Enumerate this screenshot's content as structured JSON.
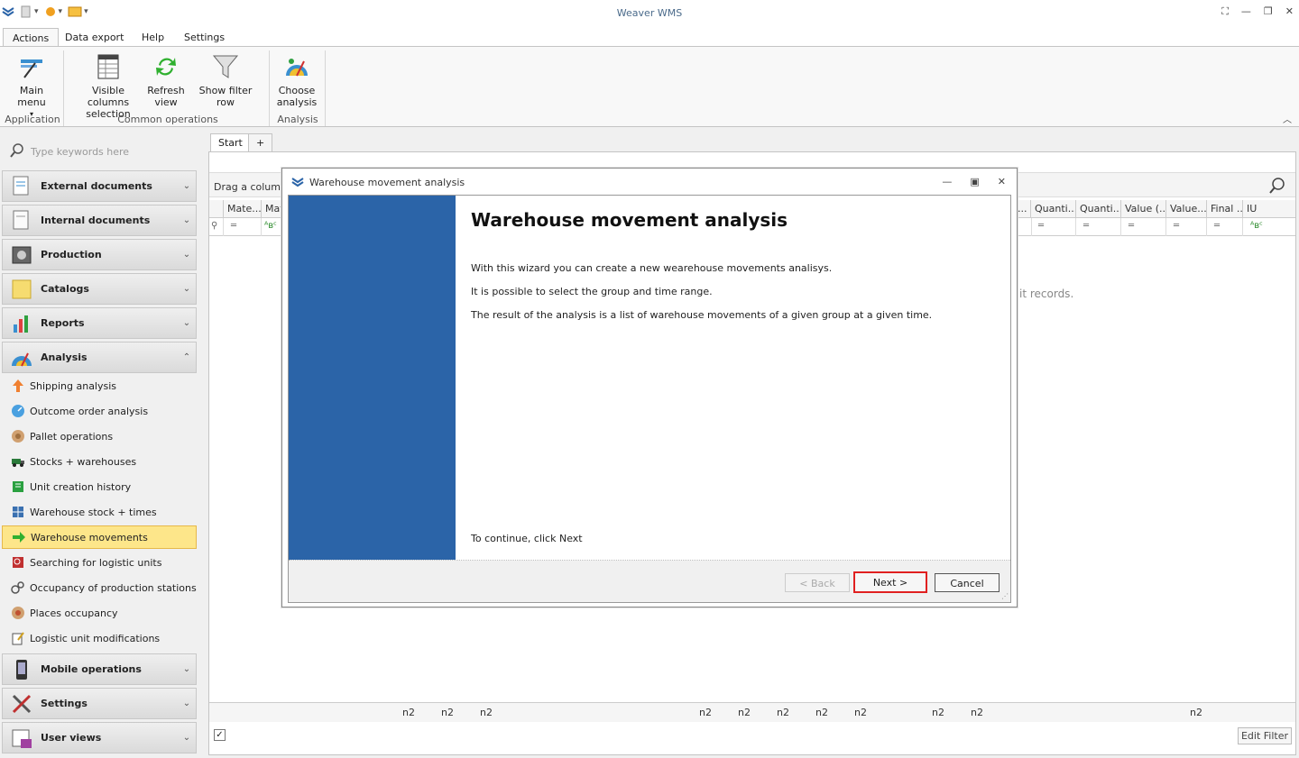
{
  "app": {
    "title": "Weaver WMS"
  },
  "ribbon": {
    "tabs": [
      "Actions",
      "Data export",
      "Help",
      "Settings"
    ],
    "buttons": {
      "main_menu": "Main menu",
      "visible_columns": "Visible columns selection",
      "refresh_view": "Refresh view",
      "show_filter_row": "Show filter row",
      "choose_analysis": "Choose analysis"
    },
    "groups": {
      "application": "Application",
      "common_operations": "Common operations",
      "analysis": "Analysis"
    }
  },
  "sidebar": {
    "search_placeholder": "Type keywords here",
    "groups": [
      "External documents",
      "Internal documents",
      "Production",
      "Catalogs",
      "Reports",
      "Analysis",
      "Mobile operations",
      "Settings",
      "User views"
    ],
    "analysis_items": [
      "Shipping analysis",
      "Outcome order analysis",
      "Pallet operations",
      "Stocks + warehouses",
      "Unit creation history",
      "Warehouse stock + times",
      "Warehouse movements",
      "Searching for logistic units",
      "Occupancy of production stations",
      "Places occupancy",
      "Logistic unit modifications"
    ],
    "selected_item": "Warehouse movements"
  },
  "main": {
    "tabs": [
      "Start",
      "+"
    ],
    "group_panel_text": "Drag a column h",
    "columns": [
      "Mate...",
      "Mat",
      "...",
      "Quanti...",
      "Quanti...",
      "Value (...",
      "Value...",
      "Final ...",
      "IU"
    ],
    "no_records_text": "it records.",
    "footer_label": "n2",
    "edit_filter": "Edit Filter",
    "filter_checkbox": "✓"
  },
  "dialog": {
    "title": "Warehouse movement analysis",
    "heading": "Warehouse movement analysis",
    "lines": [
      "With this wizard you can create a new wearehouse movements analisys.",
      "It is possible to select the group and time range.",
      "The result of the analysis is a list of warehouse movements of a given group at a given time."
    ],
    "continue_text": "To continue, click Next",
    "back_label": "< Back",
    "next_label": "Next >",
    "cancel_label": "Cancel"
  },
  "colors": {
    "accent_blue": "#2b64a8",
    "selected_item_bg": "#fde68a",
    "highlight_red": "#e02020"
  }
}
